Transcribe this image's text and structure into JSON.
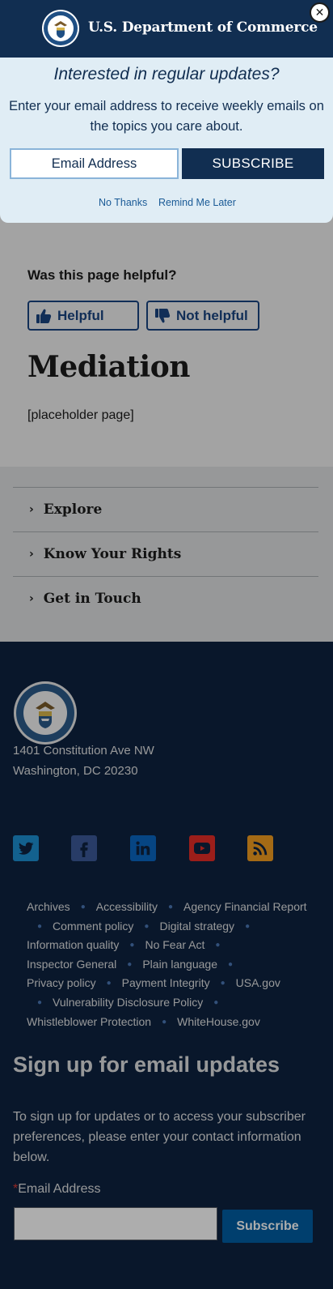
{
  "popup": {
    "brand": "U.S. Department of Commerce",
    "question": "Interested in regular updates?",
    "description": "Enter your email address to receive weekly emails on the topics you care about.",
    "email_placeholder": "Email Address",
    "subscribe_label": "SUBSCRIBE",
    "no_thanks": "No Thanks",
    "remind_later": "Remind Me Later",
    "close_glyph": "✕"
  },
  "feedback": {
    "title": "Was this page helpful?",
    "helpful_label": "Helpful",
    "not_helpful_label": "Not helpful"
  },
  "page": {
    "title": "Mediation",
    "body": "[placeholder page]"
  },
  "accordion": {
    "items": [
      {
        "label": "Explore"
      },
      {
        "label": "Know Your Rights"
      },
      {
        "label": "Get in Touch"
      }
    ]
  },
  "footer": {
    "address_line1": "1401 Constitution Ave NW",
    "address_line2": "Washington, DC 20230",
    "social": [
      {
        "icon": "twitter-icon",
        "color": "#1d8fd1"
      },
      {
        "icon": "facebook-icon",
        "color": "#3b5998"
      },
      {
        "icon": "linkedin-icon",
        "color": "#0a66c2"
      },
      {
        "icon": "youtube-icon",
        "color": "#e52d27"
      },
      {
        "icon": "rss-icon",
        "color": "#f29c1f"
      }
    ],
    "links": [
      "Archives",
      "Accessibility",
      "Agency Financial Report",
      "Comment policy",
      "Digital strategy",
      "Information quality",
      "No Fear Act",
      "Inspector General",
      "Plain language",
      "Privacy policy",
      "Payment Integrity",
      "USA.gov",
      "Vulnerability Disclosure Policy",
      "Whistleblower Protection",
      "WhiteHouse.gov"
    ],
    "signup_title": "Sign up for email updates",
    "signup_description": "To sign up for updates or to access your subscriber preferences, please enter your contact information below.",
    "email_label": "Email Address",
    "required_mark": "*",
    "subscribe_label": "Subscribe"
  },
  "colors": {
    "navy": "#112e51",
    "footer_bg": "#0e2240",
    "accent_blue": "#1a4480"
  }
}
